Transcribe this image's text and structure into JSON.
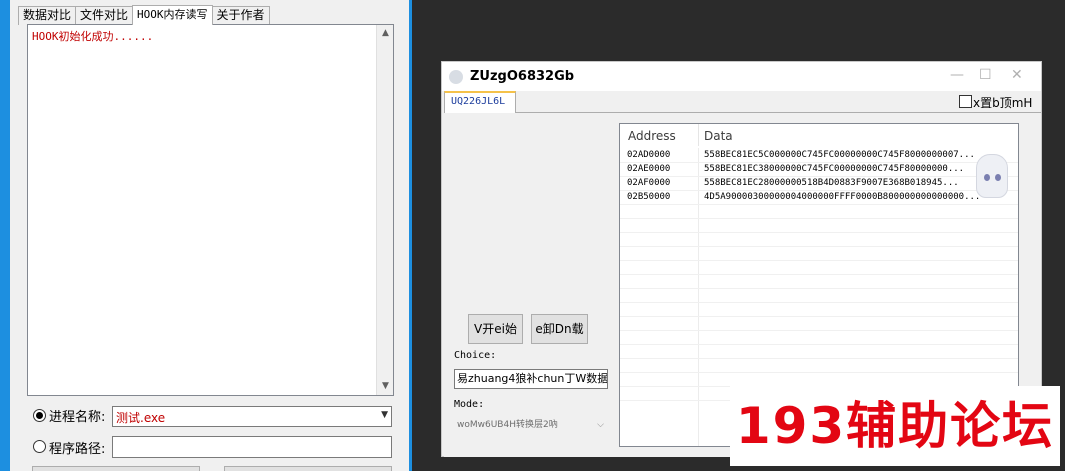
{
  "left_window": {
    "tabs": [
      "数据对比",
      "文件对比",
      "HOOK内存读写",
      "关于作者"
    ],
    "active_tab_index": 2,
    "log_text": "HOOK初始化成功......",
    "process_label": "进程名称:",
    "process_value": "测试.exe",
    "path_label": "程序路径:",
    "path_value": ""
  },
  "right_window": {
    "title": "ZUzgO6832Gb",
    "tab_label": "UQ226JL6L",
    "checkbox_label": "x置b顶mH",
    "list_headers": [
      "Address",
      "Data"
    ],
    "rows": [
      {
        "address": "02AD0000",
        "data": "558BEC81EC5C000000C745FC00000000C745F8000000007..."
      },
      {
        "address": "02AE0000",
        "data": "558BEC81EC38000000C745FC00000000C745F80000000..."
      },
      {
        "address": "02AF0000",
        "data": "558BEC81EC28000000518B4D0883F9007E368B018945..."
      },
      {
        "address": "02B50000",
        "data": "4D5A90000300000004000000FFFF0000B800000000000000..."
      }
    ],
    "button_start": "V开ei始",
    "button_unload": "e卸Dn载",
    "choice_label": "Choice:",
    "choice_value": "易zhuang4狼补chun丁W数据|",
    "mode_label": "Mode:",
    "mode_value": "woMw6UB4H转换层2吶"
  },
  "watermark": "193辅助论坛",
  "colors": {
    "accent_red": "#e30613",
    "log_red": "#c00000",
    "window_blue": "#1d8fe0"
  }
}
